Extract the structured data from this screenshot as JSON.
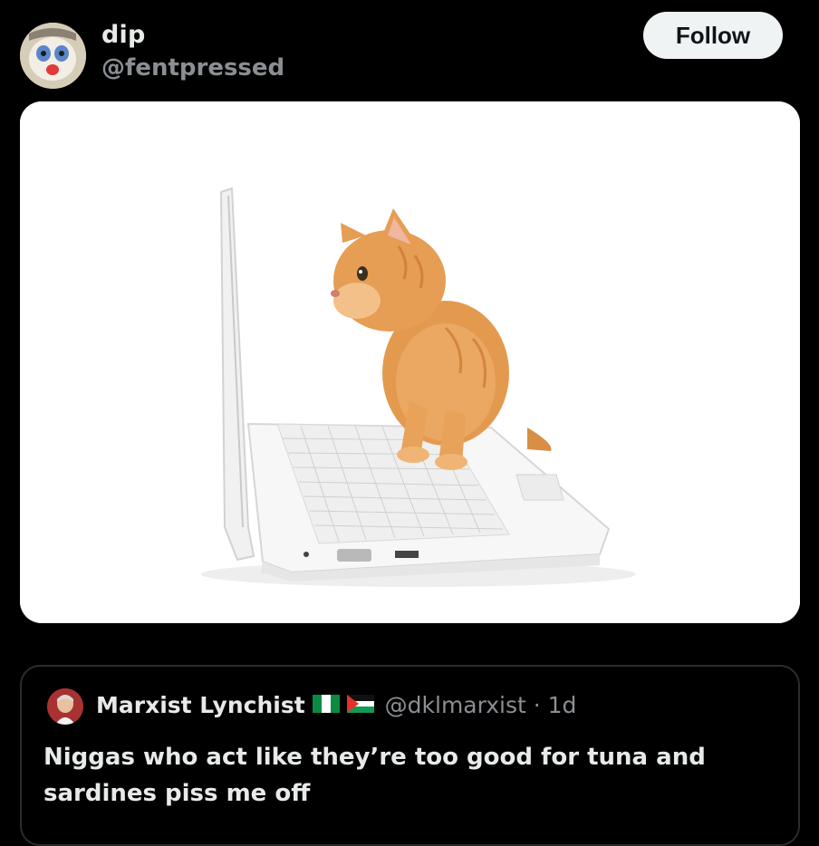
{
  "post": {
    "display_name": "dip",
    "handle": "@fentpressed",
    "follow_label": "Follow"
  },
  "media": {
    "icon": "photo-kitten-on-laptop"
  },
  "quoted_post": {
    "display_name": "Marxist Lynchist",
    "flags": [
      "nigeria-flag-icon",
      "palestine-flag-icon"
    ],
    "handle_and_time": "@dklmarxist · 1d",
    "text": "Niggas who act like they’re too good for tuna and sardines piss me off"
  },
  "colors": {
    "background": "#000000",
    "primary_text": "#e7e9ea",
    "secondary_text": "#8b8f94",
    "follow_button_bg": "#eff3f4",
    "card_border": "#2a2d30"
  }
}
